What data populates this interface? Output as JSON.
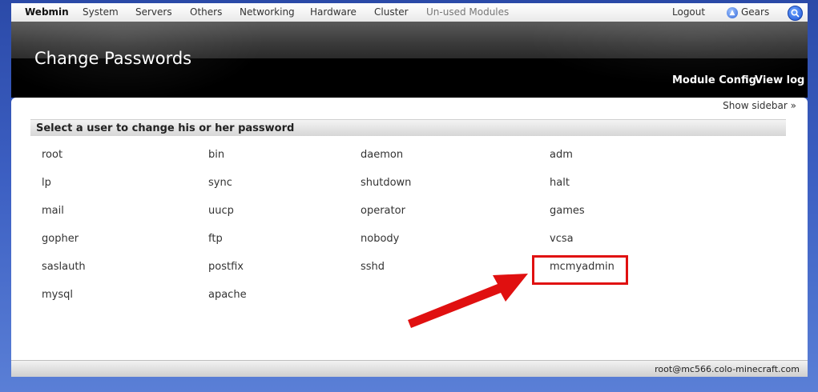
{
  "topmenu": {
    "items": [
      "Webmin",
      "System",
      "Servers",
      "Others",
      "Networking",
      "Hardware",
      "Cluster",
      "Un-used Modules"
    ],
    "logout": "Logout",
    "gears": "Gears"
  },
  "header": {
    "title": "Change Passwords",
    "module_config": "Module Config",
    "view_log": "View log"
  },
  "content": {
    "show_sidebar": "Show sidebar »",
    "section_title": "Select a user to change his or her password",
    "users": [
      [
        "root",
        "bin",
        "daemon",
        "adm"
      ],
      [
        "lp",
        "sync",
        "shutdown",
        "halt"
      ],
      [
        "mail",
        "uucp",
        "operator",
        "games"
      ],
      [
        "gopher",
        "ftp",
        "nobody",
        "vcsa"
      ],
      [
        "saslauth",
        "postfix",
        "sshd",
        "mcmyadmin"
      ],
      [
        "mysql",
        "apache"
      ]
    ]
  },
  "annotation": {
    "highlight_color": "#e01010",
    "highlighted_user": "mcmyadmin"
  },
  "footer": {
    "user_host": "root@mc566.colo-minecraft.com"
  }
}
